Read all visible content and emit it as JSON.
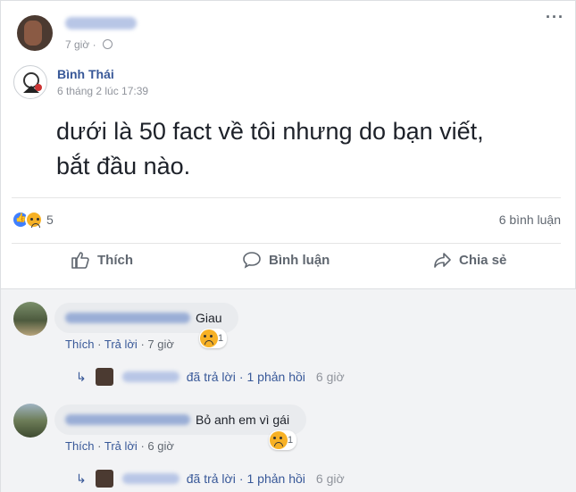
{
  "header": {
    "author_name": "Phạm Tín",
    "time": "7 giờ",
    "more_label": "···"
  },
  "shared_post": {
    "author": "Bình Thái",
    "time": "6 tháng 2 lúc 17:39",
    "text_line1": "dưới là 50 fact về tôi nhưng do bạn viết,",
    "text_line2": "bắt đầu nào."
  },
  "stats": {
    "reaction_count": "5",
    "comment_count": "6 bình luận"
  },
  "actions": {
    "like": "Thích",
    "comment": "Bình luận",
    "share": "Chia sẻ"
  },
  "comments": [
    {
      "author": "Nguyễn Duy Hùng",
      "text": "Giau",
      "like": "Thích",
      "reply": "Trả lời",
      "time": "7 giờ",
      "reaction_count": "1",
      "reply_info": {
        "author": "Phạm Tín",
        "label": "đã trả lời",
        "count": "1 phản hồi",
        "time": "6 giờ"
      }
    },
    {
      "author": "Phú Minh Dương",
      "text": "Bỏ anh em vì gái",
      "like": "Thích",
      "reply": "Trả lời",
      "time": "6 giờ",
      "reaction_count": "1",
      "reply_info": {
        "author": "Phạm Tín",
        "label": "đã trả lời",
        "count": "1 phản hồi",
        "time": "6 giờ"
      }
    }
  ],
  "separator": "·",
  "colors": {
    "link": "#385898",
    "meta": "#90949c",
    "like_blue": "#4080ff",
    "sad_yellow": "#f7b125",
    "comment_bg": "#f2f3f5"
  }
}
